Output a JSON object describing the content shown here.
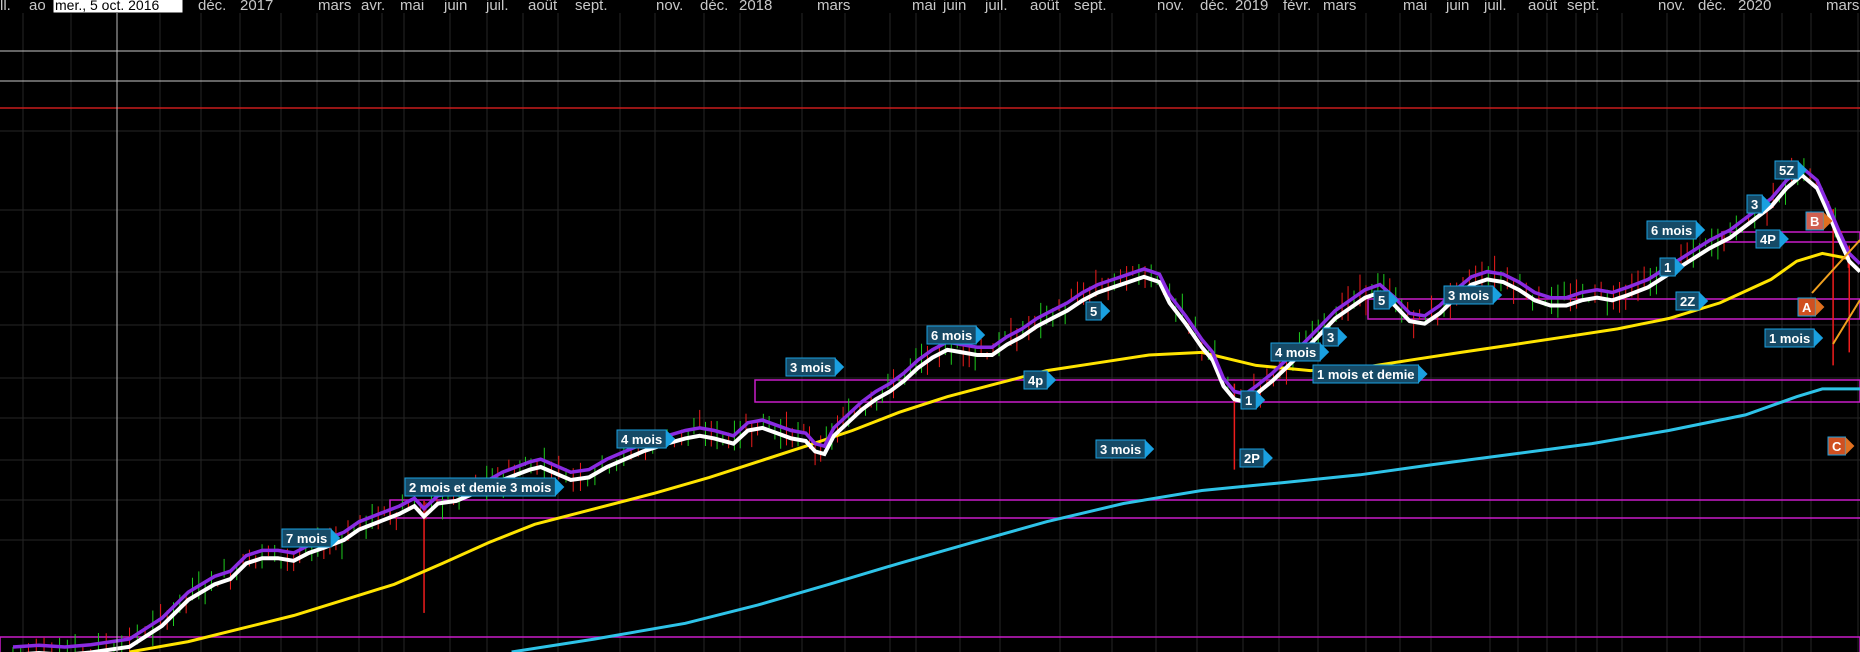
{
  "colors": {
    "background": "#000000",
    "grid": "#262626",
    "up": "#1ecc1e",
    "down": "#ee1c1c",
    "price_avg": "#ffffff",
    "ma_short": "#8a2be2",
    "ma_mid": "#ffe400",
    "ma_long": "#2ec3e8",
    "zone": "#c81cc8",
    "hline": "#c8c8c8",
    "red_line": "#c81c1c",
    "label_fill": "#164a66",
    "label_stroke": "#1aa0e0"
  },
  "cursor_readout": "mer., 5 oct. 2016",
  "chart_data": {
    "type": "line",
    "x_axis_labels": [
      "ll.",
      "ao",
      "déc.",
      "2017",
      "mars",
      "avr.",
      "mai",
      "juin",
      "juil.",
      "août",
      "sept.",
      "nov.",
      "déc.",
      "2018",
      "mars",
      "mai",
      "juin",
      "juil.",
      "août",
      "sept.",
      "nov.",
      "déc.",
      "2019",
      "févr.",
      "mars",
      "mai",
      "juin",
      "juil.",
      "août",
      "sept.",
      "nov.",
      "déc.",
      "2020",
      "mars"
    ],
    "x_range": [
      "2016-07-01",
      "2020-03-25"
    ],
    "y_range": [
      0,
      100
    ],
    "grid": true,
    "series": [
      {
        "values": [
          [
            0.02,
            0.9
          ],
          [
            0.06,
            1.6
          ],
          [
            0.1,
            0.9
          ],
          [
            0.14,
            1.8
          ],
          [
            0.2,
            4
          ],
          [
            0.25,
            12
          ],
          [
            0.3,
            22
          ],
          [
            0.35,
            28
          ],
          [
            0.38,
            30
          ],
          [
            0.41,
            36
          ],
          [
            0.44,
            38
          ],
          [
            0.47,
            38
          ],
          [
            0.5,
            37
          ],
          [
            0.53,
            40
          ],
          [
            0.56,
            42
          ],
          [
            0.6,
            45
          ],
          [
            0.63,
            49
          ],
          [
            0.67,
            52
          ],
          [
            0.71,
            55
          ],
          [
            0.74,
            58
          ],
          [
            0.76,
            54
          ],
          [
            0.79,
            59
          ],
          [
            0.83,
            60
          ],
          [
            0.87,
            63
          ],
          [
            0.9,
            65
          ],
          [
            0.93,
            68
          ],
          [
            0.96,
            70
          ],
          [
            0.99,
            72
          ],
          [
            1.01,
            73
          ],
          [
            1.03,
            71
          ],
          [
            1.06,
            68
          ],
          [
            1.09,
            69
          ],
          [
            1.12,
            73
          ],
          [
            1.15,
            76
          ],
          [
            1.18,
            79
          ],
          [
            1.22,
            82
          ],
          [
            1.25,
            84
          ],
          [
            1.28,
            85
          ],
          [
            1.31,
            84
          ],
          [
            1.35,
            82
          ],
          [
            1.38,
            87
          ],
          [
            1.41,
            88
          ],
          [
            1.44,
            86
          ],
          [
            1.47,
            84
          ],
          [
            1.5,
            83
          ],
          [
            1.52,
            79
          ],
          [
            1.54,
            78
          ],
          [
            1.56,
            85
          ],
          [
            1.59,
            90
          ],
          [
            1.62,
            95
          ],
          [
            1.65,
            99
          ],
          [
            1.68,
            102
          ],
          [
            1.71,
            106
          ],
          [
            1.74,
            111
          ],
          [
            1.77,
            115
          ],
          [
            1.8,
            118
          ],
          [
            1.83,
            117
          ],
          [
            1.86,
            116
          ],
          [
            1.89,
            116
          ],
          [
            1.92,
            120
          ],
          [
            1.95,
            123
          ],
          [
            1.98,
            127
          ],
          [
            2.01,
            130
          ],
          [
            2.04,
            133
          ],
          [
            2.07,
            137
          ],
          [
            2.1,
            140
          ],
          [
            2.13,
            142
          ],
          [
            2.16,
            144
          ],
          [
            2.19,
            146
          ],
          [
            2.22,
            144
          ],
          [
            2.24,
            136
          ],
          [
            2.27,
            128
          ],
          [
            2.3,
            119
          ],
          [
            2.32,
            114
          ],
          [
            2.34,
            104
          ],
          [
            2.36,
            99
          ],
          [
            2.38,
            98
          ],
          [
            2.4,
            101
          ],
          [
            2.43,
            106
          ],
          [
            2.46,
            112
          ],
          [
            2.49,
            118
          ],
          [
            2.52,
            124
          ],
          [
            2.55,
            130
          ],
          [
            2.58,
            134
          ],
          [
            2.61,
            138
          ],
          [
            2.64,
            140
          ],
          [
            2.67,
            135
          ],
          [
            2.7,
            129
          ],
          [
            2.73,
            128
          ],
          [
            2.76,
            132
          ],
          [
            2.79,
            138
          ],
          [
            2.82,
            143
          ],
          [
            2.85,
            145
          ],
          [
            2.88,
            144
          ],
          [
            2.91,
            141
          ],
          [
            2.94,
            137
          ],
          [
            2.97,
            135
          ],
          [
            3.0,
            135
          ],
          [
            3.03,
            137
          ],
          [
            3.06,
            138
          ],
          [
            3.09,
            137
          ],
          [
            3.12,
            139
          ],
          [
            3.16,
            142
          ],
          [
            3.2,
            147
          ],
          [
            3.24,
            152
          ],
          [
            3.28,
            157
          ],
          [
            3.32,
            161
          ],
          [
            3.36,
            167
          ],
          [
            3.4,
            173
          ],
          [
            3.43,
            180
          ],
          [
            3.46,
            185
          ],
          [
            3.49,
            180
          ],
          [
            3.51,
            171
          ],
          [
            3.53,
            161
          ],
          [
            3.55,
            152
          ],
          [
            3.57,
            148
          ]
        ]
      },
      {
        "values": [
          [
            0.2,
            0
          ],
          [
            0.3,
            4
          ],
          [
            0.4,
            9
          ],
          [
            0.5,
            14
          ],
          [
            0.6,
            20
          ],
          [
            0.7,
            26
          ],
          [
            0.8,
            34
          ],
          [
            0.9,
            42
          ],
          [
            1.0,
            49
          ],
          [
            1.1,
            55
          ],
          [
            1.2,
            61
          ],
          [
            1.3,
            67
          ],
          [
            1.4,
            73
          ],
          [
            1.5,
            79
          ],
          [
            1.6,
            85
          ],
          [
            1.7,
            92
          ],
          [
            1.8,
            98
          ],
          [
            1.9,
            103
          ],
          [
            2.0,
            108
          ],
          [
            2.1,
            111
          ],
          [
            2.2,
            114
          ],
          [
            2.3,
            115
          ],
          [
            2.4,
            110
          ],
          [
            2.5,
            108
          ],
          [
            2.6,
            109
          ],
          [
            2.7,
            112
          ],
          [
            2.8,
            115
          ],
          [
            2.9,
            118
          ],
          [
            3.0,
            121
          ],
          [
            3.1,
            124
          ],
          [
            3.2,
            128
          ],
          [
            3.3,
            134
          ],
          [
            3.4,
            143
          ],
          [
            3.45,
            150
          ],
          [
            3.5,
            153
          ],
          [
            3.55,
            151
          ]
        ]
      },
      {
        "values": [
          [
            0.95,
            0
          ],
          [
            1.1,
            5
          ],
          [
            1.25,
            11
          ],
          [
            1.4,
            18
          ],
          [
            1.55,
            26
          ],
          [
            1.7,
            34
          ],
          [
            1.85,
            42
          ],
          [
            2.0,
            50
          ],
          [
            2.15,
            57
          ],
          [
            2.3,
            62
          ],
          [
            2.45,
            65
          ],
          [
            2.6,
            68
          ],
          [
            2.75,
            72
          ],
          [
            2.9,
            76
          ],
          [
            3.05,
            80
          ],
          [
            3.2,
            85
          ],
          [
            3.35,
            91
          ],
          [
            3.45,
            98
          ],
          [
            3.5,
            101
          ],
          [
            3.57,
            101
          ]
        ]
      }
    ]
  },
  "labels": [
    {
      "text": "7 mois"
    },
    {
      "text": "2 mois et demie 3 mois"
    },
    {
      "text": "4 mois"
    },
    {
      "text": "3 mois"
    },
    {
      "text": "6 mois"
    },
    {
      "text": "4p"
    },
    {
      "text": "5"
    },
    {
      "text": "3 mois"
    },
    {
      "text": "2P"
    },
    {
      "text": "1"
    },
    {
      "text": "4 mois"
    },
    {
      "text": "3"
    },
    {
      "text": "1 mois et demie"
    },
    {
      "text": "5"
    },
    {
      "text": "3 mois"
    },
    {
      "text": "2Z"
    },
    {
      "text": "1"
    },
    {
      "text": "6 mois"
    },
    {
      "text": "4P"
    },
    {
      "text": "3"
    },
    {
      "text": "5Z"
    },
    {
      "text": "1 mois"
    },
    {
      "text": "B"
    },
    {
      "text": "A"
    },
    {
      "text": "C"
    }
  ]
}
